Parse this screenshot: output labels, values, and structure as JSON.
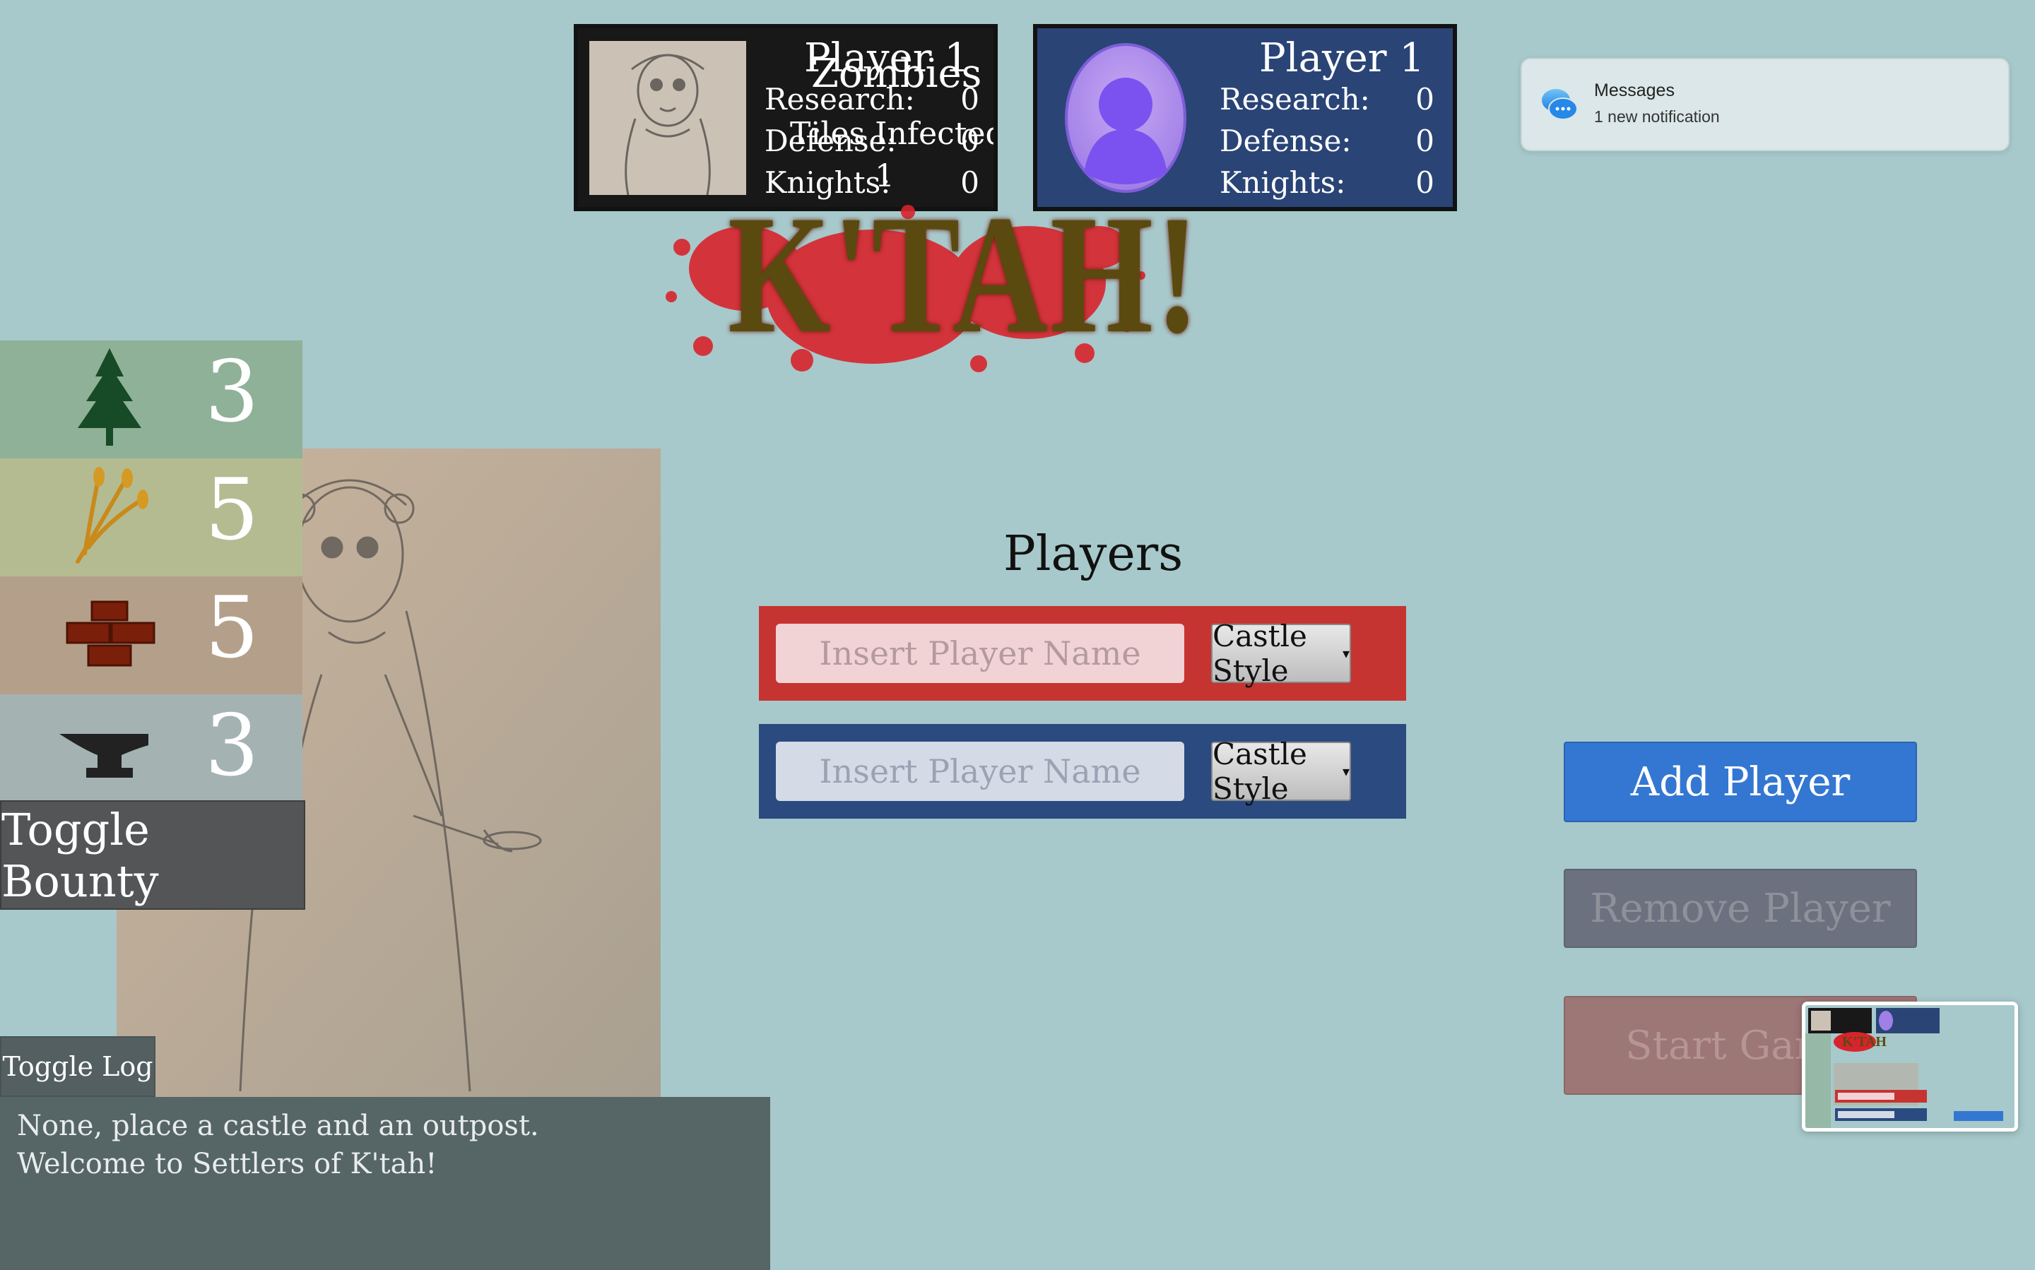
{
  "zombies_card": {
    "name_line1": "Player 1",
    "name_line2": "Zombies",
    "overlay": "Tiles Infected",
    "overlay_value": "1",
    "stats": [
      {
        "label": "Research:",
        "value": "0"
      },
      {
        "label": "Defense:",
        "value": "0"
      },
      {
        "label": "Knights:",
        "value": "0"
      }
    ]
  },
  "player_card": {
    "name": "Player 1",
    "stats": [
      {
        "label": "Research:",
        "value": "0"
      },
      {
        "label": "Defense:",
        "value": "0"
      },
      {
        "label": "Knights:",
        "value": "0"
      }
    ]
  },
  "logo": {
    "text": "K'TAH!"
  },
  "notification": {
    "app": "Messages",
    "message": "1 new notification"
  },
  "resources": [
    {
      "icon": "tree-icon",
      "value": "3",
      "color": "#8fb197"
    },
    {
      "icon": "wheat-icon",
      "value": "5",
      "color": "#b5bb91"
    },
    {
      "icon": "brick-icon",
      "value": "5",
      "color": "#b4a08a"
    },
    {
      "icon": "anvil-icon",
      "value": "3",
      "color": "#a4b2b2"
    }
  ],
  "sidebar": {
    "toggle_bounty": "Toggle Bounty",
    "toggle_log": "Toggle Log"
  },
  "log": {
    "lines": [
      "None, place a castle and an outpost.",
      "Welcome to Settlers of K'tah!"
    ]
  },
  "players": {
    "title": "Players",
    "rows": [
      {
        "placeholder": "Insert Player Name",
        "castle_label": "Castle Style",
        "color": "#c53431"
      },
      {
        "placeholder": "Insert Player Name",
        "castle_label": "Castle Style",
        "color": "#2a4a80"
      }
    ]
  },
  "actions": {
    "add": "Add Player",
    "remove": "Remove Player",
    "start": "Start Game"
  }
}
